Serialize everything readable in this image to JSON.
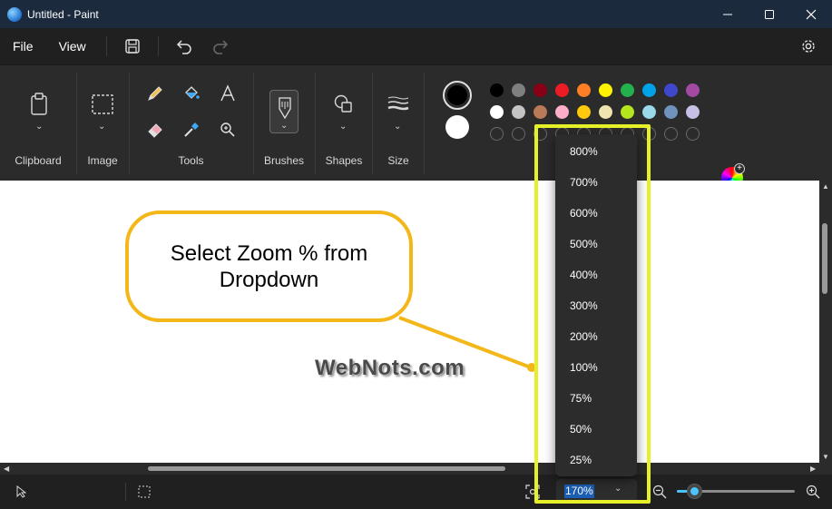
{
  "window": {
    "title": "Untitled - Paint"
  },
  "menu": {
    "file": "File",
    "view": "View"
  },
  "ribbon": {
    "groups": {
      "clipboard": "Clipboard",
      "image": "Image",
      "tools": "Tools",
      "brushes": "Brushes",
      "shapes": "Shapes",
      "size": "Size"
    }
  },
  "colors": {
    "primary": "#000000",
    "secondary": "#ffffff",
    "row1": [
      "#000000",
      "#7f7f7f",
      "#880015",
      "#ed1c24",
      "#ff7f27",
      "#fff200",
      "#22b14c",
      "#00a2e8",
      "#3f48cc",
      "#a349a4"
    ],
    "row2": [
      "#ffffff",
      "#c3c3c3",
      "#b97a57",
      "#ffaec9",
      "#ffc90e",
      "#efe4b0",
      "#b5e61d",
      "#99d9ea",
      "#7092be",
      "#c8bfe7"
    ]
  },
  "callout": {
    "text": "Select Zoom % from Dropdown"
  },
  "watermark": "WebNots.com",
  "zoom": {
    "current": "170%",
    "options": [
      "800%",
      "700%",
      "600%",
      "500%",
      "400%",
      "300%",
      "200%",
      "100%",
      "75%",
      "50%",
      "25%"
    ]
  },
  "accent": {
    "highlight": "#e6f028",
    "callout_border": "#f3b71a",
    "selection": "#1a5fb4"
  }
}
